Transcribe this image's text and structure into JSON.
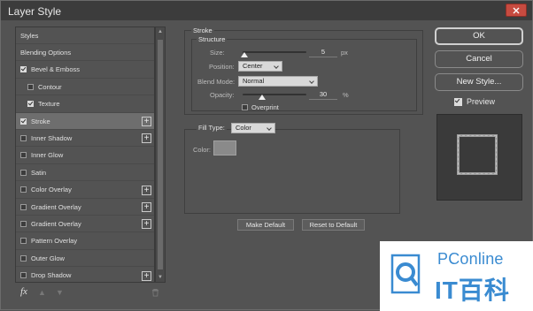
{
  "window": {
    "title": "Layer Style"
  },
  "styles_list": {
    "items": [
      {
        "label": "Styles",
        "checkbox": false,
        "checked": false,
        "plus": false,
        "indent": false,
        "selected": false
      },
      {
        "label": "Blending Options",
        "checkbox": false,
        "checked": false,
        "plus": false,
        "indent": false,
        "selected": false
      },
      {
        "label": "Bevel & Emboss",
        "checkbox": true,
        "checked": true,
        "plus": false,
        "indent": false,
        "selected": false
      },
      {
        "label": "Contour",
        "checkbox": true,
        "checked": false,
        "plus": false,
        "indent": true,
        "selected": false
      },
      {
        "label": "Texture",
        "checkbox": true,
        "checked": true,
        "plus": false,
        "indent": true,
        "selected": false
      },
      {
        "label": "Stroke",
        "checkbox": true,
        "checked": true,
        "plus": true,
        "indent": false,
        "selected": true
      },
      {
        "label": "Inner Shadow",
        "checkbox": true,
        "checked": false,
        "plus": true,
        "indent": false,
        "selected": false
      },
      {
        "label": "Inner Glow",
        "checkbox": true,
        "checked": false,
        "plus": false,
        "indent": false,
        "selected": false
      },
      {
        "label": "Satin",
        "checkbox": true,
        "checked": false,
        "plus": false,
        "indent": false,
        "selected": false
      },
      {
        "label": "Color Overlay",
        "checkbox": true,
        "checked": false,
        "plus": true,
        "indent": false,
        "selected": false
      },
      {
        "label": "Gradient Overlay",
        "checkbox": true,
        "checked": false,
        "plus": true,
        "indent": false,
        "selected": false
      },
      {
        "label": "Gradient Overlay",
        "checkbox": true,
        "checked": false,
        "plus": true,
        "indent": false,
        "selected": false
      },
      {
        "label": "Pattern Overlay",
        "checkbox": true,
        "checked": false,
        "plus": false,
        "indent": false,
        "selected": false
      },
      {
        "label": "Outer Glow",
        "checkbox": true,
        "checked": false,
        "plus": false,
        "indent": false,
        "selected": false
      },
      {
        "label": "Drop Shadow",
        "checkbox": true,
        "checked": false,
        "plus": true,
        "indent": false,
        "selected": false
      }
    ],
    "footer": {
      "fx_label": "fx"
    }
  },
  "stroke": {
    "section_title": "Stroke",
    "structure_title": "Structure",
    "size": {
      "label": "Size:",
      "value": "5",
      "unit": "px",
      "slider_fraction": 0.03
    },
    "position": {
      "label": "Position:",
      "value": "Center"
    },
    "blend_mode": {
      "label": "Blend Mode:",
      "value": "Normal"
    },
    "opacity": {
      "label": "Opacity:",
      "value": "30",
      "unit": "%",
      "slider_fraction": 0.3
    },
    "overprint": {
      "label": "Overprint",
      "checked": false
    },
    "fill_type": {
      "label": "Fill Type:",
      "value": "Color"
    },
    "color": {
      "label": "Color:",
      "swatch": "#8a8a8a"
    },
    "make_default_label": "Make Default",
    "reset_default_label": "Reset to Default"
  },
  "actions": {
    "ok_label": "OK",
    "cancel_label": "Cancel",
    "new_style_label": "New Style...",
    "preview_label": "Preview",
    "preview_checked": true
  },
  "watermark": {
    "top_text": "PConline",
    "bottom_text": "IT百科"
  },
  "colors": {
    "panel_bg": "#535353",
    "selected_row": "#6e6e6e",
    "close_button": "#c74b40",
    "brand_blue": "#3a8bd1"
  },
  "icons": {
    "close": "close-icon",
    "checkbox": "checkbox-icon",
    "plus": "plus-icon",
    "fx": "fx-icon",
    "move_up": "arrow-up-icon",
    "move_down": "arrow-down-icon",
    "trash": "trash-icon",
    "logo": "pconline-logo-icon"
  }
}
